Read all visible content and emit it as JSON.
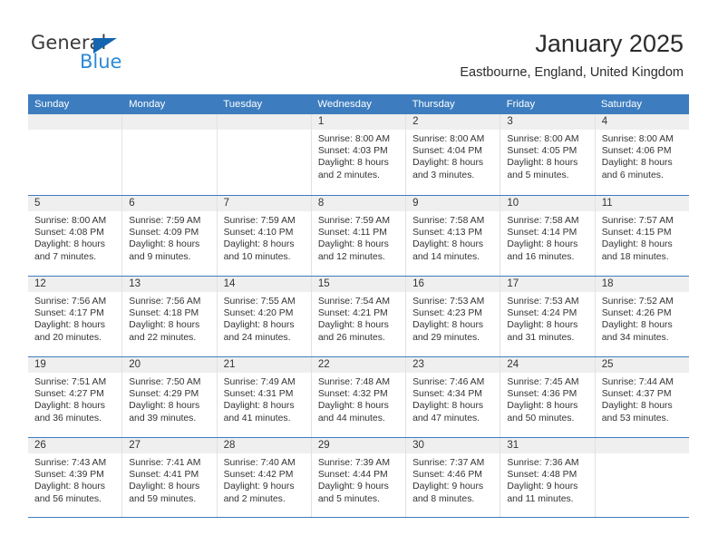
{
  "logo": {
    "text_primary": "General",
    "text_secondary": "Blue",
    "triangle_color": "#1565b0",
    "primary_color": "#3b3b3b",
    "secondary_color": "#2d89d6"
  },
  "header": {
    "title": "January 2025",
    "subtitle": "Eastbourne, England, United Kingdom"
  },
  "theme": {
    "header_blue": "#3d7dbf",
    "daynum_band": "#efefef",
    "cell_border": "#e2e2e2",
    "text": "#333333"
  },
  "calendar": {
    "day_headers": [
      "Sunday",
      "Monday",
      "Tuesday",
      "Wednesday",
      "Thursday",
      "Friday",
      "Saturday"
    ],
    "weeks": [
      [
        {
          "day": "",
          "empty": true
        },
        {
          "day": "",
          "empty": true
        },
        {
          "day": "",
          "empty": true
        },
        {
          "day": "1",
          "sunrise": "Sunrise: 8:00 AM",
          "sunset": "Sunset: 4:03 PM",
          "daylight": "Daylight: 8 hours and 2 minutes."
        },
        {
          "day": "2",
          "sunrise": "Sunrise: 8:00 AM",
          "sunset": "Sunset: 4:04 PM",
          "daylight": "Daylight: 8 hours and 3 minutes."
        },
        {
          "day": "3",
          "sunrise": "Sunrise: 8:00 AM",
          "sunset": "Sunset: 4:05 PM",
          "daylight": "Daylight: 8 hours and 5 minutes."
        },
        {
          "day": "4",
          "sunrise": "Sunrise: 8:00 AM",
          "sunset": "Sunset: 4:06 PM",
          "daylight": "Daylight: 8 hours and 6 minutes."
        }
      ],
      [
        {
          "day": "5",
          "sunrise": "Sunrise: 8:00 AM",
          "sunset": "Sunset: 4:08 PM",
          "daylight": "Daylight: 8 hours and 7 minutes."
        },
        {
          "day": "6",
          "sunrise": "Sunrise: 7:59 AM",
          "sunset": "Sunset: 4:09 PM",
          "daylight": "Daylight: 8 hours and 9 minutes."
        },
        {
          "day": "7",
          "sunrise": "Sunrise: 7:59 AM",
          "sunset": "Sunset: 4:10 PM",
          "daylight": "Daylight: 8 hours and 10 minutes."
        },
        {
          "day": "8",
          "sunrise": "Sunrise: 7:59 AM",
          "sunset": "Sunset: 4:11 PM",
          "daylight": "Daylight: 8 hours and 12 minutes."
        },
        {
          "day": "9",
          "sunrise": "Sunrise: 7:58 AM",
          "sunset": "Sunset: 4:13 PM",
          "daylight": "Daylight: 8 hours and 14 minutes."
        },
        {
          "day": "10",
          "sunrise": "Sunrise: 7:58 AM",
          "sunset": "Sunset: 4:14 PM",
          "daylight": "Daylight: 8 hours and 16 minutes."
        },
        {
          "day": "11",
          "sunrise": "Sunrise: 7:57 AM",
          "sunset": "Sunset: 4:15 PM",
          "daylight": "Daylight: 8 hours and 18 minutes."
        }
      ],
      [
        {
          "day": "12",
          "sunrise": "Sunrise: 7:56 AM",
          "sunset": "Sunset: 4:17 PM",
          "daylight": "Daylight: 8 hours and 20 minutes."
        },
        {
          "day": "13",
          "sunrise": "Sunrise: 7:56 AM",
          "sunset": "Sunset: 4:18 PM",
          "daylight": "Daylight: 8 hours and 22 minutes."
        },
        {
          "day": "14",
          "sunrise": "Sunrise: 7:55 AM",
          "sunset": "Sunset: 4:20 PM",
          "daylight": "Daylight: 8 hours and 24 minutes."
        },
        {
          "day": "15",
          "sunrise": "Sunrise: 7:54 AM",
          "sunset": "Sunset: 4:21 PM",
          "daylight": "Daylight: 8 hours and 26 minutes."
        },
        {
          "day": "16",
          "sunrise": "Sunrise: 7:53 AM",
          "sunset": "Sunset: 4:23 PM",
          "daylight": "Daylight: 8 hours and 29 minutes."
        },
        {
          "day": "17",
          "sunrise": "Sunrise: 7:53 AM",
          "sunset": "Sunset: 4:24 PM",
          "daylight": "Daylight: 8 hours and 31 minutes."
        },
        {
          "day": "18",
          "sunrise": "Sunrise: 7:52 AM",
          "sunset": "Sunset: 4:26 PM",
          "daylight": "Daylight: 8 hours and 34 minutes."
        }
      ],
      [
        {
          "day": "19",
          "sunrise": "Sunrise: 7:51 AM",
          "sunset": "Sunset: 4:27 PM",
          "daylight": "Daylight: 8 hours and 36 minutes."
        },
        {
          "day": "20",
          "sunrise": "Sunrise: 7:50 AM",
          "sunset": "Sunset: 4:29 PM",
          "daylight": "Daylight: 8 hours and 39 minutes."
        },
        {
          "day": "21",
          "sunrise": "Sunrise: 7:49 AM",
          "sunset": "Sunset: 4:31 PM",
          "daylight": "Daylight: 8 hours and 41 minutes."
        },
        {
          "day": "22",
          "sunrise": "Sunrise: 7:48 AM",
          "sunset": "Sunset: 4:32 PM",
          "daylight": "Daylight: 8 hours and 44 minutes."
        },
        {
          "day": "23",
          "sunrise": "Sunrise: 7:46 AM",
          "sunset": "Sunset: 4:34 PM",
          "daylight": "Daylight: 8 hours and 47 minutes."
        },
        {
          "day": "24",
          "sunrise": "Sunrise: 7:45 AM",
          "sunset": "Sunset: 4:36 PM",
          "daylight": "Daylight: 8 hours and 50 minutes."
        },
        {
          "day": "25",
          "sunrise": "Sunrise: 7:44 AM",
          "sunset": "Sunset: 4:37 PM",
          "daylight": "Daylight: 8 hours and 53 minutes."
        }
      ],
      [
        {
          "day": "26",
          "sunrise": "Sunrise: 7:43 AM",
          "sunset": "Sunset: 4:39 PM",
          "daylight": "Daylight: 8 hours and 56 minutes."
        },
        {
          "day": "27",
          "sunrise": "Sunrise: 7:41 AM",
          "sunset": "Sunset: 4:41 PM",
          "daylight": "Daylight: 8 hours and 59 minutes."
        },
        {
          "day": "28",
          "sunrise": "Sunrise: 7:40 AM",
          "sunset": "Sunset: 4:42 PM",
          "daylight": "Daylight: 9 hours and 2 minutes."
        },
        {
          "day": "29",
          "sunrise": "Sunrise: 7:39 AM",
          "sunset": "Sunset: 4:44 PM",
          "daylight": "Daylight: 9 hours and 5 minutes."
        },
        {
          "day": "30",
          "sunrise": "Sunrise: 7:37 AM",
          "sunset": "Sunset: 4:46 PM",
          "daylight": "Daylight: 9 hours and 8 minutes."
        },
        {
          "day": "31",
          "sunrise": "Sunrise: 7:36 AM",
          "sunset": "Sunset: 4:48 PM",
          "daylight": "Daylight: 9 hours and 11 minutes."
        },
        {
          "day": "",
          "empty": true
        }
      ]
    ]
  }
}
